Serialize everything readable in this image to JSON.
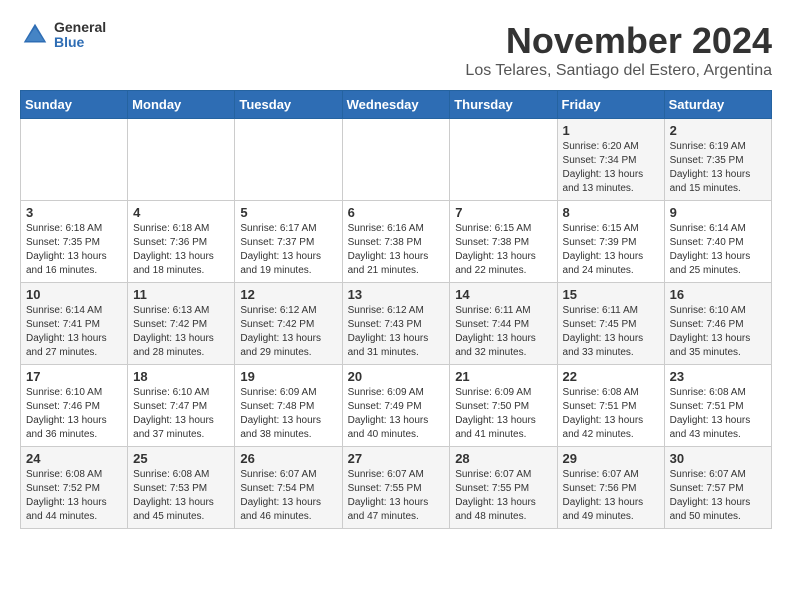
{
  "header": {
    "logo_general": "General",
    "logo_blue": "Blue",
    "month_title": "November 2024",
    "location": "Los Telares, Santiago del Estero, Argentina"
  },
  "weekdays": [
    "Sunday",
    "Monday",
    "Tuesday",
    "Wednesday",
    "Thursday",
    "Friday",
    "Saturday"
  ],
  "weeks": [
    [
      {
        "day": "",
        "info": ""
      },
      {
        "day": "",
        "info": ""
      },
      {
        "day": "",
        "info": ""
      },
      {
        "day": "",
        "info": ""
      },
      {
        "day": "",
        "info": ""
      },
      {
        "day": "1",
        "info": "Sunrise: 6:20 AM\nSunset: 7:34 PM\nDaylight: 13 hours and 13 minutes."
      },
      {
        "day": "2",
        "info": "Sunrise: 6:19 AM\nSunset: 7:35 PM\nDaylight: 13 hours and 15 minutes."
      }
    ],
    [
      {
        "day": "3",
        "info": "Sunrise: 6:18 AM\nSunset: 7:35 PM\nDaylight: 13 hours and 16 minutes."
      },
      {
        "day": "4",
        "info": "Sunrise: 6:18 AM\nSunset: 7:36 PM\nDaylight: 13 hours and 18 minutes."
      },
      {
        "day": "5",
        "info": "Sunrise: 6:17 AM\nSunset: 7:37 PM\nDaylight: 13 hours and 19 minutes."
      },
      {
        "day": "6",
        "info": "Sunrise: 6:16 AM\nSunset: 7:38 PM\nDaylight: 13 hours and 21 minutes."
      },
      {
        "day": "7",
        "info": "Sunrise: 6:15 AM\nSunset: 7:38 PM\nDaylight: 13 hours and 22 minutes."
      },
      {
        "day": "8",
        "info": "Sunrise: 6:15 AM\nSunset: 7:39 PM\nDaylight: 13 hours and 24 minutes."
      },
      {
        "day": "9",
        "info": "Sunrise: 6:14 AM\nSunset: 7:40 PM\nDaylight: 13 hours and 25 minutes."
      }
    ],
    [
      {
        "day": "10",
        "info": "Sunrise: 6:14 AM\nSunset: 7:41 PM\nDaylight: 13 hours and 27 minutes."
      },
      {
        "day": "11",
        "info": "Sunrise: 6:13 AM\nSunset: 7:42 PM\nDaylight: 13 hours and 28 minutes."
      },
      {
        "day": "12",
        "info": "Sunrise: 6:12 AM\nSunset: 7:42 PM\nDaylight: 13 hours and 29 minutes."
      },
      {
        "day": "13",
        "info": "Sunrise: 6:12 AM\nSunset: 7:43 PM\nDaylight: 13 hours and 31 minutes."
      },
      {
        "day": "14",
        "info": "Sunrise: 6:11 AM\nSunset: 7:44 PM\nDaylight: 13 hours and 32 minutes."
      },
      {
        "day": "15",
        "info": "Sunrise: 6:11 AM\nSunset: 7:45 PM\nDaylight: 13 hours and 33 minutes."
      },
      {
        "day": "16",
        "info": "Sunrise: 6:10 AM\nSunset: 7:46 PM\nDaylight: 13 hours and 35 minutes."
      }
    ],
    [
      {
        "day": "17",
        "info": "Sunrise: 6:10 AM\nSunset: 7:46 PM\nDaylight: 13 hours and 36 minutes."
      },
      {
        "day": "18",
        "info": "Sunrise: 6:10 AM\nSunset: 7:47 PM\nDaylight: 13 hours and 37 minutes."
      },
      {
        "day": "19",
        "info": "Sunrise: 6:09 AM\nSunset: 7:48 PM\nDaylight: 13 hours and 38 minutes."
      },
      {
        "day": "20",
        "info": "Sunrise: 6:09 AM\nSunset: 7:49 PM\nDaylight: 13 hours and 40 minutes."
      },
      {
        "day": "21",
        "info": "Sunrise: 6:09 AM\nSunset: 7:50 PM\nDaylight: 13 hours and 41 minutes."
      },
      {
        "day": "22",
        "info": "Sunrise: 6:08 AM\nSunset: 7:51 PM\nDaylight: 13 hours and 42 minutes."
      },
      {
        "day": "23",
        "info": "Sunrise: 6:08 AM\nSunset: 7:51 PM\nDaylight: 13 hours and 43 minutes."
      }
    ],
    [
      {
        "day": "24",
        "info": "Sunrise: 6:08 AM\nSunset: 7:52 PM\nDaylight: 13 hours and 44 minutes."
      },
      {
        "day": "25",
        "info": "Sunrise: 6:08 AM\nSunset: 7:53 PM\nDaylight: 13 hours and 45 minutes."
      },
      {
        "day": "26",
        "info": "Sunrise: 6:07 AM\nSunset: 7:54 PM\nDaylight: 13 hours and 46 minutes."
      },
      {
        "day": "27",
        "info": "Sunrise: 6:07 AM\nSunset: 7:55 PM\nDaylight: 13 hours and 47 minutes."
      },
      {
        "day": "28",
        "info": "Sunrise: 6:07 AM\nSunset: 7:55 PM\nDaylight: 13 hours and 48 minutes."
      },
      {
        "day": "29",
        "info": "Sunrise: 6:07 AM\nSunset: 7:56 PM\nDaylight: 13 hours and 49 minutes."
      },
      {
        "day": "30",
        "info": "Sunrise: 6:07 AM\nSunset: 7:57 PM\nDaylight: 13 hours and 50 minutes."
      }
    ]
  ]
}
